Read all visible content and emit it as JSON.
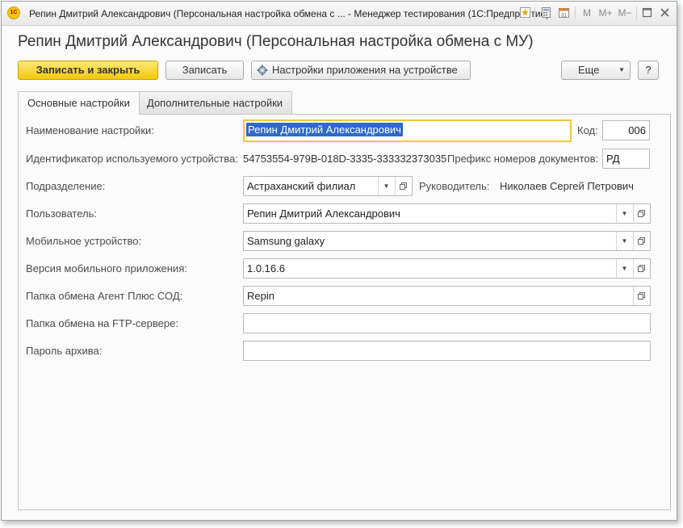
{
  "window": {
    "title": "Репин Дмитрий Александрович (Персональная настройка обмена с ... - Менеджер тестирования (1С:Предприятие)",
    "app_icon_text": "1С",
    "m_label": "M",
    "m_plus_label": "M+",
    "m_minus_label": "M−"
  },
  "page_title": "Репин Дмитрий Александрович (Персональная настройка обмена с МУ)",
  "toolbar": {
    "save_close_label": "Записать и закрыть",
    "save_label": "Записать",
    "app_settings_label": "Настройки приложения на устройстве",
    "more_label": "Еще",
    "help_label": "?"
  },
  "tabs": [
    {
      "label": "Основные настройки"
    },
    {
      "label": "Дополнительные настройки"
    }
  ],
  "form": {
    "name_label": "Наименование настройки:",
    "name_value": "Репин Дмитрий Александрович",
    "code_label": "Код:",
    "code_value": "006",
    "device_id_label": "Идентификатор используемого устройства:",
    "device_id_value": "54753554-979B-018D-3335-333332373035",
    "prefix_label": "Префикс номеров документов:",
    "prefix_value": "РД",
    "division_label": "Подразделение:",
    "division_value": "Астраханский филиал",
    "manager_label": "Руководитель:",
    "manager_value": "Николаев Сергей Петрович",
    "user_label": "Пользователь:",
    "user_value": "Репин Дмитрий Александрович",
    "mobile_device_label": "Мобильное устройство:",
    "mobile_device_value": "Samsung galaxy",
    "app_version_label": "Версия мобильного приложения:",
    "app_version_value": "1.0.16.6",
    "exchange_folder_label": "Папка обмена Агент Плюс СОД:",
    "exchange_folder_value": "Repin",
    "ftp_folder_label": "Папка обмена на FTP-сервере:",
    "ftp_folder_value": "",
    "archive_password_label": "Пароль архива:",
    "archive_password_value": ""
  },
  "colors": {
    "primary_button": "#f3c80a",
    "focus_border": "#f0c73d",
    "selection": "#3069c6"
  }
}
